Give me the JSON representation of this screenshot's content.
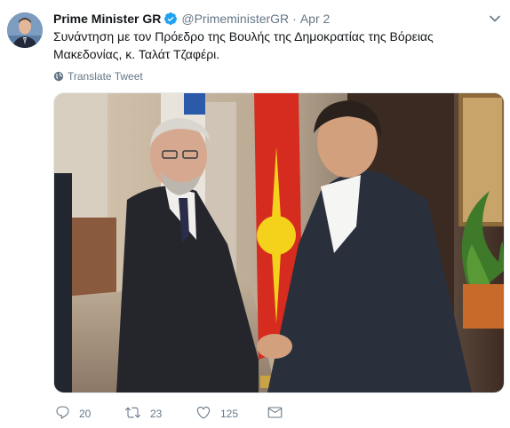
{
  "tweet": {
    "author_name": "Prime Minister GR",
    "handle": "@PrimeministerGR",
    "separator": "·",
    "date": "Apr 2",
    "text": "Συνάντηση με τον Πρόεδρο της Βουλής της Δημοκρατίας της Βόρειας Μακεδονίας, κ. Ταλάτ Τζαφέρι.",
    "translate_label": "Translate Tweet",
    "replies": "20",
    "retweets": "23",
    "likes": "125",
    "accent_color": "#1da1f2",
    "muted_color": "#657786"
  },
  "icons": {
    "verified": "verified-badge-icon",
    "caret": "chevron-down-icon",
    "globe": "globe-icon",
    "reply": "reply-icon",
    "retweet": "retweet-icon",
    "like": "heart-icon",
    "message": "envelope-icon"
  }
}
